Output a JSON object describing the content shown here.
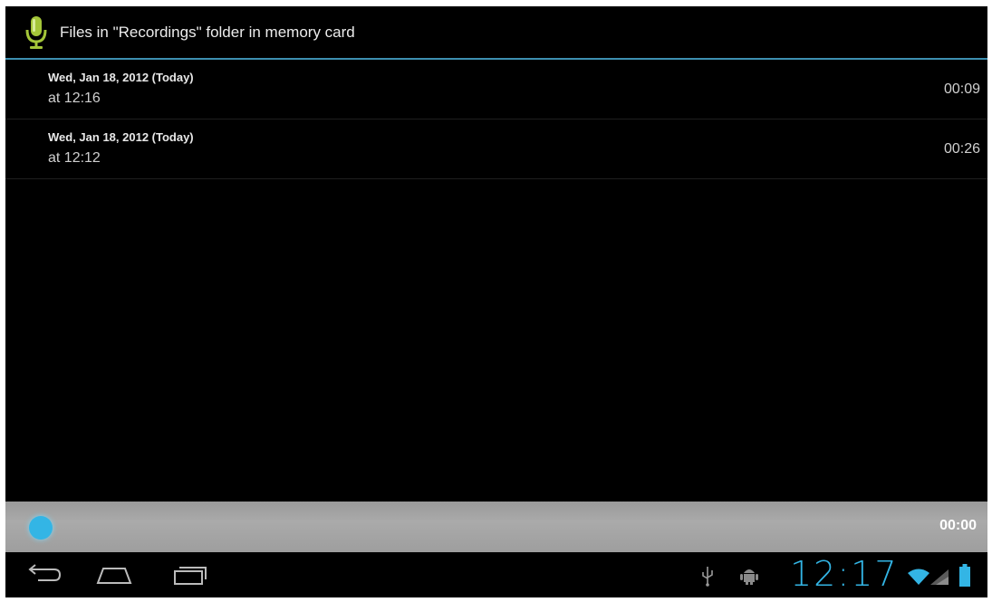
{
  "header": {
    "title": "Files in \"Recordings\" folder in memory card",
    "icon": "microphone-icon"
  },
  "recordings": [
    {
      "date": "Wed, Jan 18, 2012 (Today)",
      "time": "at 12:16",
      "duration": "00:09"
    },
    {
      "date": "Wed, Jan 18, 2012 (Today)",
      "time": "at 12:12",
      "duration": "00:26"
    }
  ],
  "player": {
    "elapsed": "00:00",
    "progress": 0
  },
  "system_bar": {
    "clock": "12:17",
    "nav_icons": [
      "back-icon",
      "home-icon",
      "recent-apps-icon"
    ],
    "status_icons": [
      "usb-icon",
      "android-debug-icon",
      "wifi-icon",
      "signal-icon",
      "battery-icon"
    ]
  },
  "colors": {
    "accent": "#33b5e5",
    "mic_green": "#a4c639",
    "divider": "#3d8fb0"
  }
}
